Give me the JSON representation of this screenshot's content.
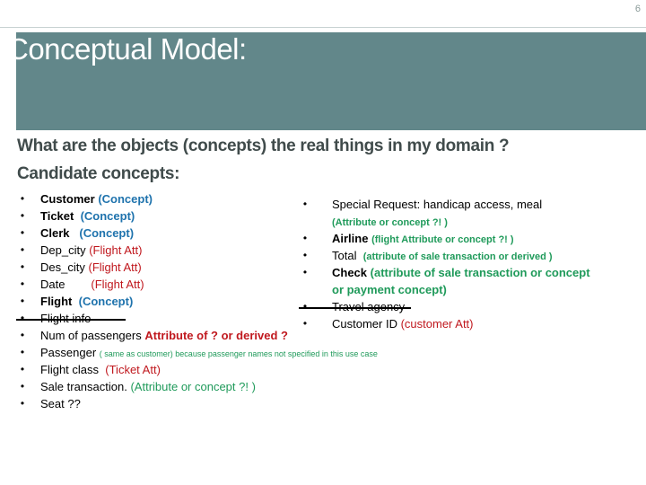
{
  "page_number": "6",
  "title": "Conceptual Model:",
  "question": "What are the objects (concepts) the real things in my domain ?",
  "subheading": "Candidate concepts:",
  "bullet_glyph": "•",
  "left_items": [
    {
      "main": "Customer",
      "note": "(Concept)"
    },
    {
      "main": "Ticket",
      "note": "(Concept)"
    },
    {
      "main": "Clerk",
      "note": "(Concept)"
    },
    {
      "main": "Dep_city",
      "note": "(Flight Att)"
    },
    {
      "main": "Des_city",
      "note": "(Flight Att)"
    },
    {
      "main": "Date",
      "note": "(Flight Att)"
    },
    {
      "main": "Flight",
      "note": "(Concept)"
    },
    {
      "main": "Flight info",
      "note": "",
      "struck": true
    },
    {
      "main": "Num of passengers",
      "note": "Attribute of ? or derived ?"
    },
    {
      "main": "Passenger",
      "note": "( same as customer) because passenger names not specified in this use case"
    },
    {
      "main": "Flight class",
      "note": "(Ticket Att)"
    },
    {
      "main": "Sale transaction.",
      "note": "(Attribute or concept ?! )"
    },
    {
      "main": "Seat ??",
      "note": ""
    }
  ],
  "right_items": [
    {
      "main": "Special Request: handicap access, meal",
      "note": "(Attribute or concept ?! )"
    },
    {
      "main": "Airline",
      "note": "(flight Attribute or concept ?! )"
    },
    {
      "main": "Total",
      "note": "(attribute of  sale transaction  or derived )"
    },
    {
      "main": "Check",
      "note": "(attribute of  sale transaction  or concept",
      "note_cont": "or payment concept)"
    },
    {
      "main": "Travel agency",
      "note": "",
      "struck": true
    },
    {
      "main": "Customer ID",
      "note": "(customer Att)"
    }
  ],
  "colors": {
    "title_band": "#62878a",
    "concept_blue": "#1f73ad",
    "attribute_red": "#c0181e",
    "question_green": "#1f9a5a",
    "heading_gray": "#404b4b"
  }
}
